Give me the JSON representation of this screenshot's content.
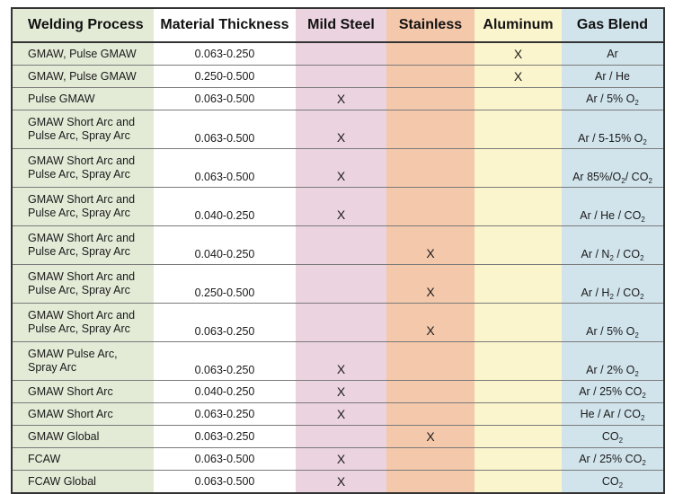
{
  "table": {
    "headers": {
      "process": "Welding Process",
      "thickness": "Material Thickness",
      "mild_steel": "Mild Steel",
      "stainless": "Stainless",
      "aluminum": "Aluminum",
      "gas_blend": "Gas Blend"
    },
    "colors": {
      "process": "#e3ebd7",
      "thickness": "#ffffff",
      "mild_steel": "#ebd3e0",
      "stainless": "#f4c8ab",
      "aluminum": "#fbf5cd",
      "gas_blend": "#d1e4ec"
    },
    "rows": [
      {
        "process": [
          "GMAW, Pulse GMAW"
        ],
        "thickness": "0.063-0.250",
        "mild_steel": "",
        "stainless": "",
        "aluminum": "X",
        "gas": [
          [
            "Ar",
            ""
          ]
        ]
      },
      {
        "process": [
          "GMAW, Pulse GMAW"
        ],
        "thickness": "0.250-0.500",
        "mild_steel": "",
        "stainless": "",
        "aluminum": "X",
        "gas": [
          [
            "Ar / He",
            ""
          ]
        ]
      },
      {
        "process": [
          "Pulse GMAW"
        ],
        "thickness": "0.063-0.500",
        "mild_steel": "X",
        "stainless": "",
        "aluminum": "",
        "gas": [
          [
            "Ar / 5% O",
            "2"
          ]
        ]
      },
      {
        "process": [
          "GMAW Short Arc and",
          "Pulse Arc, Spray Arc"
        ],
        "thickness": "0.063-0.500",
        "mild_steel": "X",
        "stainless": "",
        "aluminum": "",
        "gas": [
          [
            "Ar / 5-15% O",
            "2"
          ]
        ]
      },
      {
        "process": [
          "GMAW Short Arc and",
          "Pulse Arc, Spray Arc"
        ],
        "thickness": "0.063-0.500",
        "mild_steel": "X",
        "stainless": "",
        "aluminum": "",
        "gas": [
          [
            "Ar 85%/O",
            "2"
          ],
          [
            "/ CO",
            "2"
          ]
        ]
      },
      {
        "process": [
          "GMAW Short Arc and",
          "Pulse Arc, Spray Arc"
        ],
        "thickness": "0.040-0.250",
        "mild_steel": "X",
        "stainless": "",
        "aluminum": "",
        "gas": [
          [
            "Ar / He / CO",
            "2"
          ]
        ]
      },
      {
        "process": [
          "GMAW Short Arc and",
          "Pulse Arc, Spray Arc"
        ],
        "thickness": "0.040-0.250",
        "mild_steel": "",
        "stainless": "X",
        "aluminum": "",
        "gas": [
          [
            "Ar / N",
            "2"
          ],
          [
            " / CO",
            "2"
          ]
        ]
      },
      {
        "process": [
          "GMAW Short Arc and",
          "Pulse Arc, Spray Arc"
        ],
        "thickness": "0.250-0.500",
        "mild_steel": "",
        "stainless": "X",
        "aluminum": "",
        "gas": [
          [
            "Ar / H",
            "2"
          ],
          [
            " / CO",
            "2"
          ]
        ]
      },
      {
        "process": [
          "GMAW Short Arc and",
          "Pulse Arc, Spray Arc"
        ],
        "thickness": "0.063-0.250",
        "mild_steel": "",
        "stainless": "X",
        "aluminum": "",
        "gas": [
          [
            "Ar / 5% O",
            "2"
          ]
        ]
      },
      {
        "process": [
          "GMAW Pulse Arc,",
          "Spray Arc"
        ],
        "thickness": "0.063-0.250",
        "mild_steel": "X",
        "stainless": "",
        "aluminum": "",
        "gas": [
          [
            "Ar / 2% O",
            "2"
          ]
        ]
      },
      {
        "process": [
          "GMAW Short Arc"
        ],
        "thickness": "0.040-0.250",
        "mild_steel": "X",
        "stainless": "",
        "aluminum": "",
        "gas": [
          [
            "Ar / 25% CO",
            "2"
          ]
        ]
      },
      {
        "process": [
          "GMAW Short Arc"
        ],
        "thickness": "0.063-0.250",
        "mild_steel": "X",
        "stainless": "",
        "aluminum": "",
        "gas": [
          [
            "He / Ar / CO",
            "2"
          ]
        ]
      },
      {
        "process": [
          "GMAW Global"
        ],
        "thickness": "0.063-0.250",
        "mild_steel": "",
        "stainless": "X",
        "aluminum": "",
        "gas": [
          [
            "CO",
            "2"
          ]
        ]
      },
      {
        "process": [
          "FCAW"
        ],
        "thickness": "0.063-0.500",
        "mild_steel": "X",
        "stainless": "",
        "aluminum": "",
        "gas": [
          [
            "Ar / 25% CO",
            "2"
          ]
        ]
      },
      {
        "process": [
          "FCAW Global"
        ],
        "thickness": "0.063-0.500",
        "mild_steel": "X",
        "stainless": "",
        "aluminum": "",
        "gas": [
          [
            "CO",
            "2"
          ]
        ]
      }
    ]
  }
}
